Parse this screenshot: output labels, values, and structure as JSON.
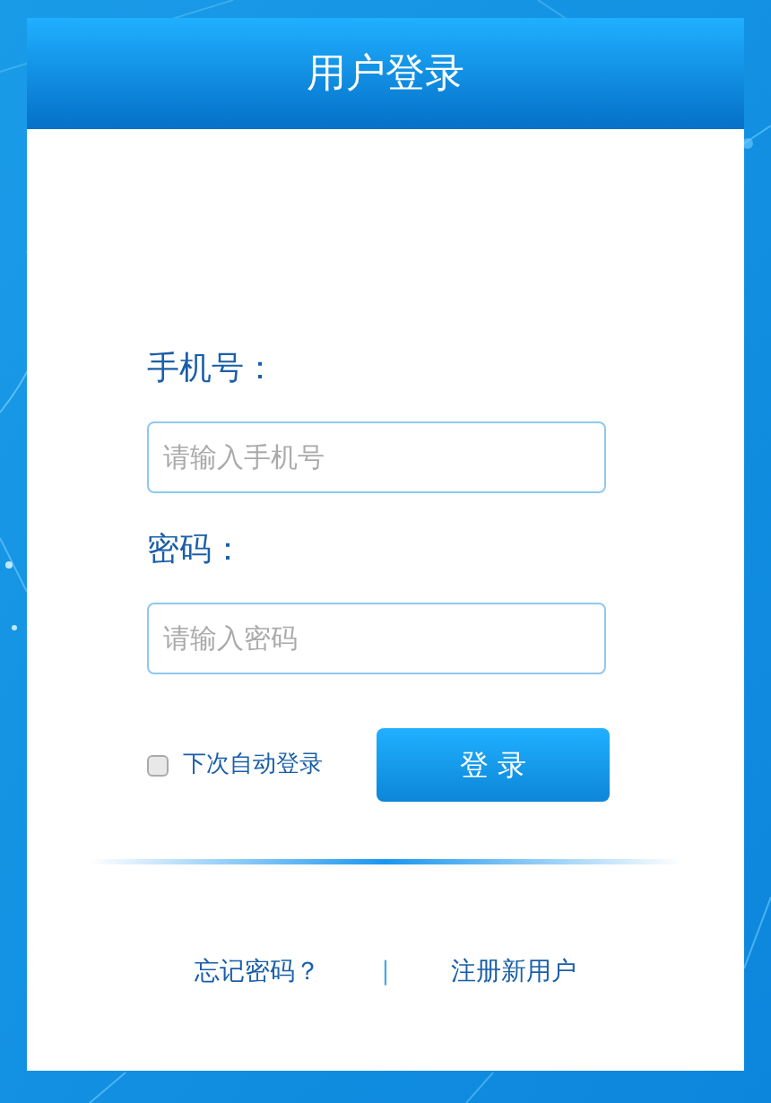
{
  "header": {
    "title": "用户登录"
  },
  "fields": [
    {
      "label": "手机号：",
      "placeholder": "请输入手机号"
    },
    {
      "label": "密码：",
      "placeholder": "请输入密码"
    }
  ],
  "remember": {
    "label": "下次自动登录",
    "checked": false
  },
  "login_button": "登 录",
  "links": {
    "forgot": "忘记密码？",
    "separator": "|",
    "register": "注册新用户"
  }
}
